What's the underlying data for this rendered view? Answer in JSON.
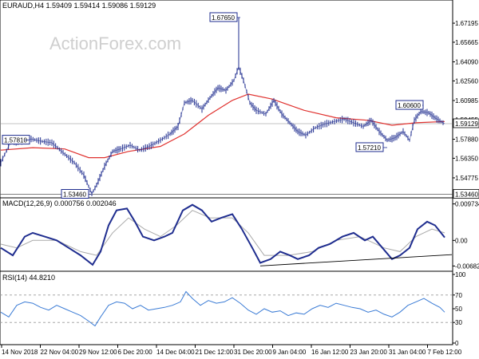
{
  "watermark": "ActionForex.com",
  "main": {
    "header": "EURAUD,H4 1.59409 1.59414 1.59086 1.59129",
    "ylim": [
      1.533,
      1.688
    ],
    "yticks": [
      "1.67195",
      "1.65665",
      "1.64090",
      "1.62560",
      "1.60985",
      "1.59455",
      "1.57880",
      "1.56350",
      "1.54775"
    ],
    "annotations": [
      "1.67650",
      "1.57810",
      "1.53460",
      "1.60600",
      "1.57210"
    ],
    "current_price": "1.59129",
    "support_price": "1.53460",
    "price_path": [
      [
        0,
        1.56
      ],
      [
        12,
        1.576
      ],
      [
        24,
        1.577
      ],
      [
        38,
        1.579
      ],
      [
        52,
        1.577
      ],
      [
        64,
        1.576
      ],
      [
        78,
        1.568
      ],
      [
        92,
        1.56
      ],
      [
        104,
        1.55
      ],
      [
        114,
        1.535
      ],
      [
        120,
        1.542
      ],
      [
        130,
        1.557
      ],
      [
        140,
        1.569
      ],
      [
        150,
        1.571
      ],
      [
        162,
        1.574
      ],
      [
        174,
        1.57
      ],
      [
        186,
        1.573
      ],
      [
        200,
        1.578
      ],
      [
        212,
        1.583
      ],
      [
        222,
        1.589
      ],
      [
        230,
        1.608
      ],
      [
        240,
        1.61
      ],
      [
        252,
        1.603
      ],
      [
        262,
        1.612
      ],
      [
        272,
        1.62
      ],
      [
        282,
        1.618
      ],
      [
        292,
        1.626
      ],
      [
        298,
        1.637
      ],
      [
        304,
        1.626
      ],
      [
        312,
        1.608
      ],
      [
        320,
        1.602
      ],
      [
        332,
        1.599
      ],
      [
        342,
        1.61
      ],
      [
        352,
        1.599
      ],
      [
        362,
        1.592
      ],
      [
        372,
        1.585
      ],
      [
        382,
        1.582
      ],
      [
        394,
        1.588
      ],
      [
        406,
        1.591
      ],
      [
        418,
        1.593
      ],
      [
        430,
        1.595
      ],
      [
        442,
        1.592
      ],
      [
        454,
        1.589
      ],
      [
        464,
        1.594
      ],
      [
        474,
        1.585
      ],
      [
        484,
        1.578
      ],
      [
        494,
        1.58
      ],
      [
        504,
        1.585
      ],
      [
        512,
        1.578
      ],
      [
        518,
        1.594
      ],
      [
        526,
        1.601
      ],
      [
        536,
        1.6
      ],
      [
        546,
        1.595
      ],
      [
        556,
        1.5913
      ]
    ],
    "ma_path": [
      [
        0,
        1.57
      ],
      [
        40,
        1.572
      ],
      [
        80,
        1.571
      ],
      [
        110,
        1.564
      ],
      [
        130,
        1.564
      ],
      [
        160,
        1.569
      ],
      [
        200,
        1.573
      ],
      [
        230,
        1.583
      ],
      [
        260,
        1.598
      ],
      [
        290,
        1.61
      ],
      [
        310,
        1.615
      ],
      [
        340,
        1.611
      ],
      [
        380,
        1.602
      ],
      [
        420,
        1.596
      ],
      [
        460,
        1.594
      ],
      [
        490,
        1.59
      ],
      [
        520,
        1.592
      ],
      [
        556,
        1.593
      ]
    ]
  },
  "macd": {
    "header": "MACD(12,26,9) 0.000756 0.002046",
    "ylim": [
      -0.0078,
      0.0105
    ],
    "yticks": [
      "0.009734",
      "0.00",
      "-0.006826"
    ],
    "macd_path": [
      [
        0,
        -0.002
      ],
      [
        15,
        -0.004
      ],
      [
        30,
        0.001
      ],
      [
        40,
        0.002
      ],
      [
        55,
        0.001
      ],
      [
        70,
        0.0
      ],
      [
        85,
        -0.002
      ],
      [
        100,
        -0.004
      ],
      [
        115,
        -0.0065
      ],
      [
        125,
        -0.003
      ],
      [
        135,
        0.004
      ],
      [
        145,
        0.008
      ],
      [
        158,
        0.0085
      ],
      [
        168,
        0.005
      ],
      [
        178,
        0.001
      ],
      [
        192,
        0.0
      ],
      [
        205,
        0.001
      ],
      [
        215,
        0.002
      ],
      [
        228,
        0.008
      ],
      [
        240,
        0.0095
      ],
      [
        252,
        0.008
      ],
      [
        264,
        0.005
      ],
      [
        276,
        0.006
      ],
      [
        290,
        0.007
      ],
      [
        302,
        0.003
      ],
      [
        315,
        -0.002
      ],
      [
        325,
        -0.006
      ],
      [
        338,
        -0.005
      ],
      [
        350,
        -0.003
      ],
      [
        362,
        -0.004
      ],
      [
        372,
        -0.005
      ],
      [
        386,
        -0.004
      ],
      [
        398,
        -0.002
      ],
      [
        412,
        -0.001
      ],
      [
        428,
        0.001
      ],
      [
        442,
        0.002
      ],
      [
        456,
        0.0
      ],
      [
        466,
        0.001
      ],
      [
        478,
        -0.002
      ],
      [
        490,
        -0.005
      ],
      [
        500,
        -0.004
      ],
      [
        512,
        -0.002
      ],
      [
        522,
        0.003
      ],
      [
        534,
        0.005
      ],
      [
        544,
        0.004
      ],
      [
        556,
        0.0008
      ]
    ],
    "signal_path": [
      [
        0,
        -0.001
      ],
      [
        20,
        -0.002
      ],
      [
        40,
        0.0
      ],
      [
        70,
        0.0
      ],
      [
        100,
        -0.003
      ],
      [
        120,
        -0.004
      ],
      [
        140,
        0.002
      ],
      [
        160,
        0.006
      ],
      [
        180,
        0.003
      ],
      [
        200,
        0.001
      ],
      [
        220,
        0.004
      ],
      [
        240,
        0.008
      ],
      [
        262,
        0.006
      ],
      [
        290,
        0.006
      ],
      [
        310,
        0.002
      ],
      [
        330,
        -0.004
      ],
      [
        360,
        -0.004
      ],
      [
        390,
        -0.003
      ],
      [
        420,
        0.0
      ],
      [
        450,
        0.001
      ],
      [
        480,
        -0.002
      ],
      [
        500,
        -0.003
      ],
      [
        520,
        0.001
      ],
      [
        540,
        0.003
      ],
      [
        556,
        0.002
      ]
    ],
    "trendline": [
      [
        325,
        -0.0068
      ],
      [
        565,
        -0.0038
      ]
    ]
  },
  "rsi": {
    "header": "RSI(14) 44.8210",
    "ylim": [
      0,
      100
    ],
    "yticks": [
      "100",
      "70",
      "50",
      "30",
      "0"
    ],
    "rsi_path": [
      [
        0,
        45
      ],
      [
        10,
        38
      ],
      [
        20,
        55
      ],
      [
        30,
        60
      ],
      [
        40,
        58
      ],
      [
        50,
        52
      ],
      [
        60,
        48
      ],
      [
        70,
        55
      ],
      [
        80,
        50
      ],
      [
        90,
        45
      ],
      [
        100,
        40
      ],
      [
        110,
        32
      ],
      [
        118,
        25
      ],
      [
        125,
        38
      ],
      [
        135,
        55
      ],
      [
        145,
        60
      ],
      [
        155,
        58
      ],
      [
        165,
        50
      ],
      [
        175,
        55
      ],
      [
        185,
        48
      ],
      [
        195,
        50
      ],
      [
        205,
        52
      ],
      [
        215,
        55
      ],
      [
        225,
        60
      ],
      [
        232,
        75
      ],
      [
        240,
        65
      ],
      [
        250,
        55
      ],
      [
        260,
        62
      ],
      [
        270,
        58
      ],
      [
        280,
        60
      ],
      [
        290,
        66
      ],
      [
        300,
        58
      ],
      [
        310,
        48
      ],
      [
        320,
        42
      ],
      [
        330,
        50
      ],
      [
        340,
        45
      ],
      [
        350,
        47
      ],
      [
        360,
        40
      ],
      [
        370,
        44
      ],
      [
        380,
        42
      ],
      [
        390,
        50
      ],
      [
        400,
        55
      ],
      [
        410,
        52
      ],
      [
        420,
        58
      ],
      [
        430,
        55
      ],
      [
        440,
        52
      ],
      [
        450,
        50
      ],
      [
        460,
        45
      ],
      [
        470,
        48
      ],
      [
        480,
        42
      ],
      [
        490,
        38
      ],
      [
        500,
        45
      ],
      [
        510,
        55
      ],
      [
        520,
        60
      ],
      [
        530,
        65
      ],
      [
        540,
        58
      ],
      [
        550,
        52
      ],
      [
        556,
        45
      ]
    ]
  },
  "xaxis": {
    "labels": [
      "14 Nov 2018",
      "22 Nov 04:00",
      "29 Nov 12:00",
      "6 Dec 20:00",
      "14 Dec 04:00",
      "21 Dec 12:00",
      "31 Dec 20:00",
      "9 Jan 04:00",
      "16 Jan 12:00",
      "23 Jan 20:00",
      "31 Jan 04:00",
      "7 Feb 12:00"
    ]
  },
  "colors": {
    "price": "#1f2d8f",
    "ma": "#e0322f",
    "macd": "#1f2d8f",
    "signal": "#aaaaaa",
    "rsi": "#3a7bd5",
    "grid": "#999999",
    "axis": "#000000"
  },
  "chart_data": {
    "type": "line",
    "symbol": "EURAUD",
    "timeframe": "H4",
    "ohlc_last": {
      "open": 1.59409,
      "high": 1.59414,
      "low": 1.59086,
      "close": 1.59129
    },
    "ylim": [
      1.533,
      1.688
    ],
    "yticks": [
      1.67195,
      1.65665,
      1.6409,
      1.6256,
      1.60985,
      1.59455,
      1.5788,
      1.5635,
      1.54775
    ],
    "x_tick_labels": [
      "14 Nov 2018",
      "22 Nov 04:00",
      "29 Nov 12:00",
      "6 Dec 20:00",
      "14 Dec 04:00",
      "21 Dec 12:00",
      "31 Dec 20:00",
      "9 Jan 04:00",
      "16 Jan 12:00",
      "23 Jan 20:00",
      "31 Jan 04:00",
      "7 Feb 12:00"
    ],
    "annotations": [
      1.6765,
      1.5781,
      1.5346,
      1.606,
      1.5721
    ],
    "indicators": {
      "macd": {
        "params": "12,26,9",
        "macd": 0.000756,
        "signal": 0.002046,
        "ylim": [
          -0.006826,
          0.009734
        ]
      },
      "rsi": {
        "period": 14,
        "value": 44.821,
        "levels": [
          70,
          50,
          30
        ]
      }
    },
    "grid": false,
    "legend": "none"
  }
}
